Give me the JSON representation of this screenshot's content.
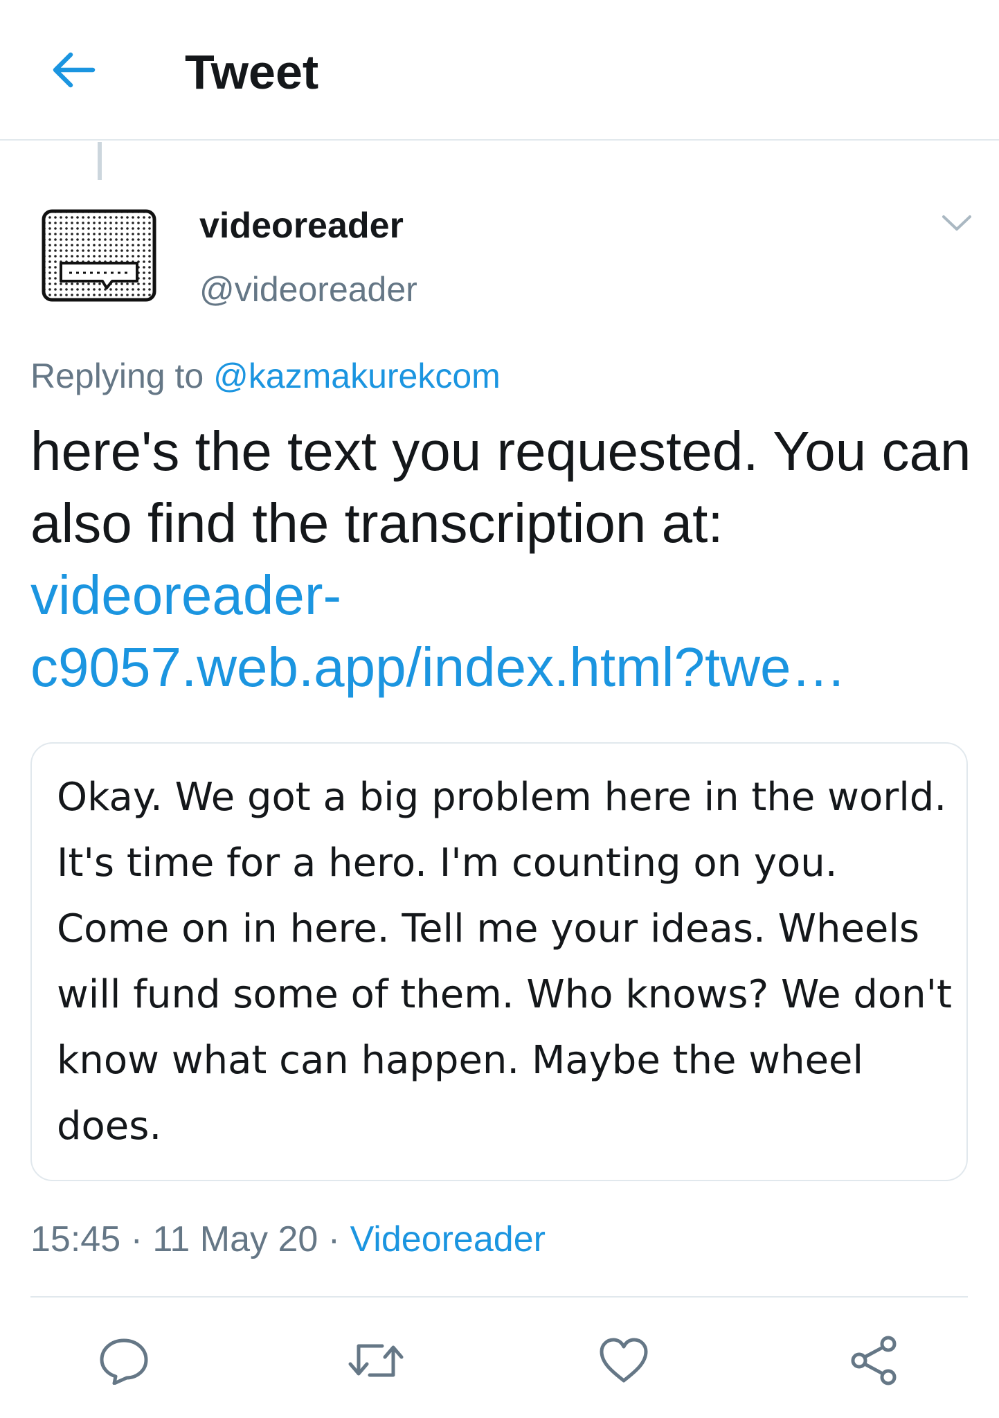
{
  "header": {
    "back_icon": "arrow-left-icon",
    "title": "Tweet"
  },
  "colors": {
    "accent": "#1b95e0",
    "secondary_text": "#657786",
    "primary_text": "#14171a",
    "border": "#e1e8ed"
  },
  "tweet": {
    "author": {
      "display_name": "videoreader",
      "handle": "@videoreader",
      "avatar_icon": "speech-bubble-avatar-icon"
    },
    "menu_icon": "chevron-down-icon",
    "replying_prefix": "Replying to",
    "replying_to": "@kazmakurekcom",
    "text_before_link": "here's the text you requested. You can also find the transcription at:",
    "link_text": "videoreader-c9057.web.app/index.html?twe…",
    "quote_text": "Okay. We got a big problem here in the world. It's time for a hero. I'm counting on you. Come on in here. Tell me your ideas. Wheels will fund some of them. Who knows? We don't know what can happen. Maybe the wheel does.",
    "time": "15:45",
    "date": "11 May 20",
    "separator": "·",
    "source": "Videoreader"
  },
  "actions": [
    {
      "icon": "reply-icon"
    },
    {
      "icon": "retweet-icon"
    },
    {
      "icon": "like-icon"
    },
    {
      "icon": "share-icon"
    }
  ]
}
